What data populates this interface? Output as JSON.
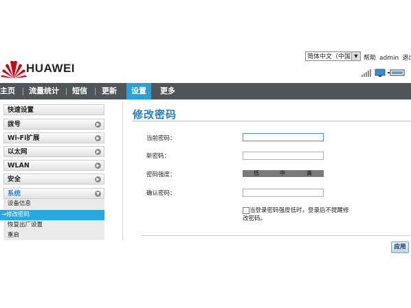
{
  "header": {
    "brand": "HUAWEI",
    "language": "简体中文（中国）",
    "help": "帮助",
    "user": "admin",
    "logout": "退出"
  },
  "nav": {
    "items": [
      {
        "label": "主页"
      },
      {
        "label": "流量统计"
      },
      {
        "label": "短信"
      },
      {
        "label": "更新"
      },
      {
        "label": "设置",
        "active": true
      },
      {
        "label": "更多"
      }
    ]
  },
  "sidebar": {
    "items": [
      {
        "label": "快速设置"
      },
      {
        "label": "拨号"
      },
      {
        "label": "Wi-Fi扩展"
      },
      {
        "label": "以太网"
      },
      {
        "label": "WLAN"
      },
      {
        "label": "安全"
      },
      {
        "label": "系统",
        "open": true
      }
    ],
    "sub_items": [
      {
        "label": "设备信息"
      },
      {
        "label": "修改密码",
        "active": true
      },
      {
        "label": "恢复出厂设置"
      },
      {
        "label": "重启"
      }
    ]
  },
  "main": {
    "title": "修改密码",
    "current_password_label": "当前密码：",
    "new_password_label": "新密码：",
    "strength_label": "密码强度：",
    "strength_levels": [
      "低",
      "中",
      "高"
    ],
    "confirm_password_label": "确认密码：",
    "checkbox_text": "当登录密码强度低时，登录后不提醒修改密码。",
    "apply_label": "应用"
  },
  "colors": {
    "nav_bg": "#4f5559",
    "accent": "#2aa0d6",
    "title": "#2480c4",
    "brand_red": "#d7000f"
  }
}
